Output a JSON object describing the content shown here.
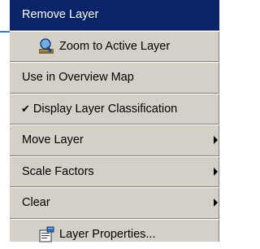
{
  "menu": {
    "items": [
      {
        "label": "Remove Layer"
      },
      {
        "label": "Zoom to Active Layer",
        "icon": "magnifier-icon"
      },
      {
        "label": "Use in Overview Map"
      },
      {
        "label": "Display Layer Classification",
        "checked": true,
        "check_glyph": "✔"
      },
      {
        "label": "Move Layer",
        "submenu": true
      },
      {
        "label": "Scale Factors",
        "submenu": true
      },
      {
        "label": "Clear",
        "submenu": true
      },
      {
        "label": "Layer Properties...",
        "icon": "properties-icon"
      }
    ]
  },
  "colors": {
    "menu_bg": "#d4d0c8",
    "highlight_bg": "#0a246a",
    "highlight_text": "#ffffff",
    "accent_line": "#2b7fc4"
  }
}
